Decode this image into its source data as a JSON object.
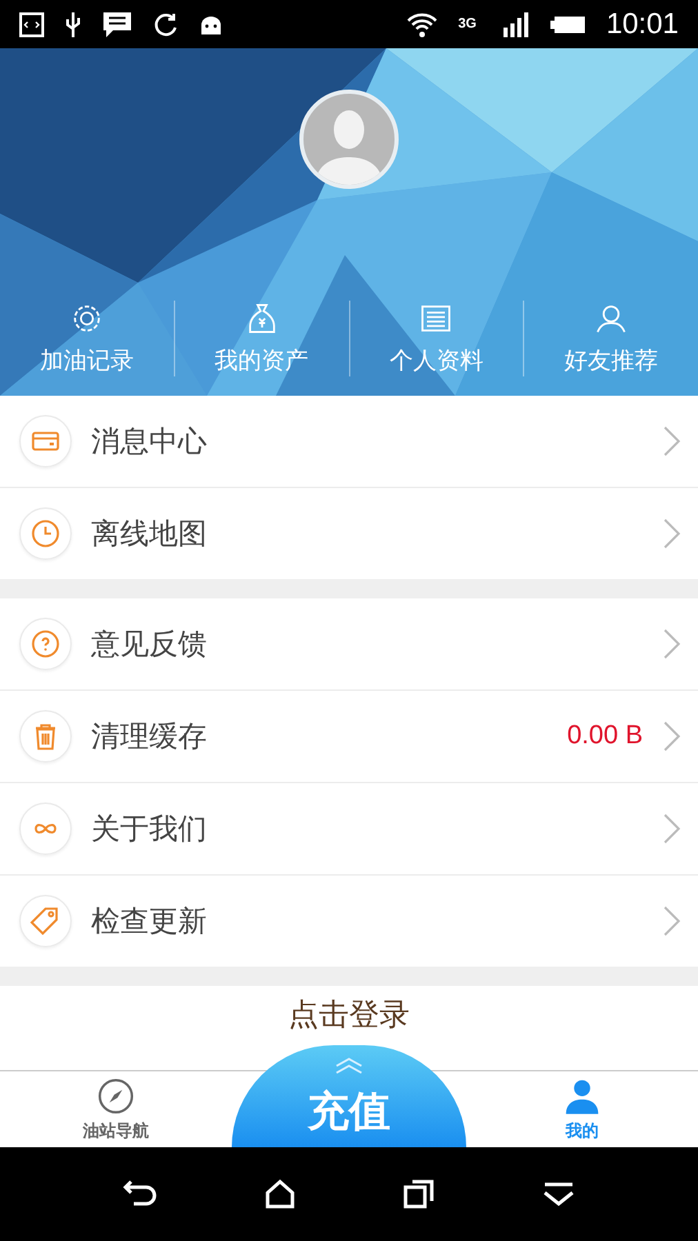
{
  "status_bar": {
    "network": "3G",
    "time": "10:01"
  },
  "header": {
    "kind": "picture",
    "actions": [
      {
        "label": "加油记录"
      },
      {
        "label": "我的资产"
      },
      {
        "label": "个人资料"
      },
      {
        "label": "好友推荐"
      }
    ]
  },
  "menu_groups": [
    [
      {
        "label": "消息中心"
      },
      {
        "label": "离线地图"
      }
    ],
    [
      {
        "label": "意见反馈"
      },
      {
        "label": "清理缓存",
        "value": "0.00 B"
      },
      {
        "label": "关于我们"
      },
      {
        "label": "检查更新"
      }
    ]
  ],
  "login_link": "点击登录",
  "tab_bar": {
    "tabs": [
      {
        "label": "油站导航",
        "selected": false
      },
      {
        "label": "我的",
        "selected": true
      }
    ],
    "center_button": "充值"
  }
}
